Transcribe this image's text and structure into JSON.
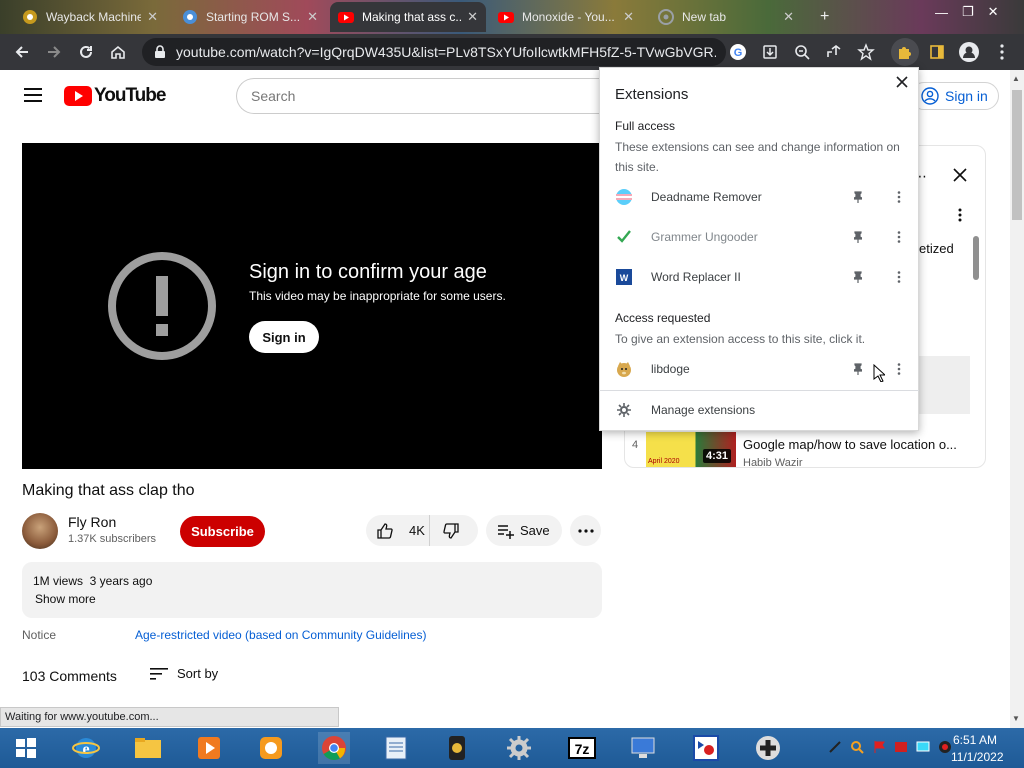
{
  "browser": {
    "tabs": [
      {
        "title": "Wayback Machine",
        "favicon_color": "#c69a1e"
      },
      {
        "title": "Starting ROM S...",
        "favicon_color": "#4a8fd8"
      },
      {
        "title": "Making that ass c...",
        "favicon_color": "#ff0000"
      },
      {
        "title": "Monoxide - You...",
        "favicon_color": "#ff0000"
      },
      {
        "title": "New tab",
        "favicon_color": "#9aa0a6"
      }
    ],
    "url": "youtube.com/watch?v=IgQrqDW435U&list=PLv8TSxYUfoIlcwtkMFH5fZ-5-TVwGbVGR..."
  },
  "youtube": {
    "logo_text": "YouTube",
    "search_placeholder": "Search",
    "sign_in": "Sign in",
    "player": {
      "age_title": "Sign in to confirm your age",
      "age_sub": "This video may be inappropriate for some users.",
      "signin_button": "Sign in"
    },
    "video_title": "Making that ass clap tho",
    "channel": {
      "name": "Fly Ron",
      "subscribers": "1.37K subscribers"
    },
    "subscribe": "Subscribe",
    "likes": "4K",
    "save": "Save",
    "description": {
      "meta": "1M views  3 years ago",
      "show_more": "Show more"
    },
    "notice_label": "Notice",
    "notice_link": "Age-restricted video (based on Community Guidelines)",
    "comments_count": "103 Comments",
    "sort_by": "Sort by",
    "playlist": {
      "partial_title": "etized",
      "item4": {
        "index": "4",
        "title": "Google map/how to save location o...",
        "channel": "Habib Wazir",
        "duration": "4:31",
        "thumb_text": "April 2020"
      }
    }
  },
  "extensions_popup": {
    "title": "Extensions",
    "full_access_heading": "Full access",
    "full_access_desc": "These extensions can see and change information on this site.",
    "full_access_items": [
      {
        "name": "Deadname Remover"
      },
      {
        "name": "Grammer Ungooder"
      },
      {
        "name": "Word Replacer II"
      }
    ],
    "access_requested_heading": "Access requested",
    "access_requested_desc": "To give an extension access to this site, click it.",
    "access_requested_items": [
      {
        "name": "libdoge"
      }
    ],
    "manage_label": "Manage extensions"
  },
  "status_text": "Waiting for www.youtube.com...",
  "taskbar": {
    "time": "6:51 AM",
    "date": "11/1/2022"
  }
}
